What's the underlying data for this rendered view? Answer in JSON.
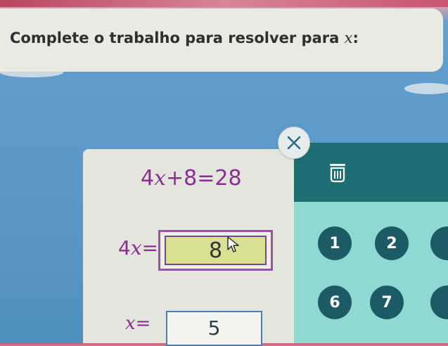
{
  "instruction": {
    "text": "Complete o trabalho para resolver para ",
    "variable": "x",
    "suffix": ":"
  },
  "work": {
    "equation_line1": {
      "coef": "4",
      "var": "x",
      "rest": "+8=28"
    },
    "equation_line2": {
      "left_coef": "4",
      "left_var": "x",
      "equals": "=",
      "answer_value": "8"
    },
    "equation_line3": {
      "left_var": "x",
      "equals": "=",
      "answer_value": "5"
    }
  },
  "keypad": {
    "keys": [
      "1",
      "2",
      "6",
      "7"
    ]
  },
  "colors": {
    "equation": "#8a2e92",
    "keypad_key": "#1c5a66",
    "keypad_bg": "#8ed9d2",
    "keypad_header": "#1d6e72",
    "highlight": "#d9e091"
  },
  "icons": {
    "close": "close-icon",
    "trash": "trash-icon",
    "cursor": "mouse-pointer-icon"
  }
}
